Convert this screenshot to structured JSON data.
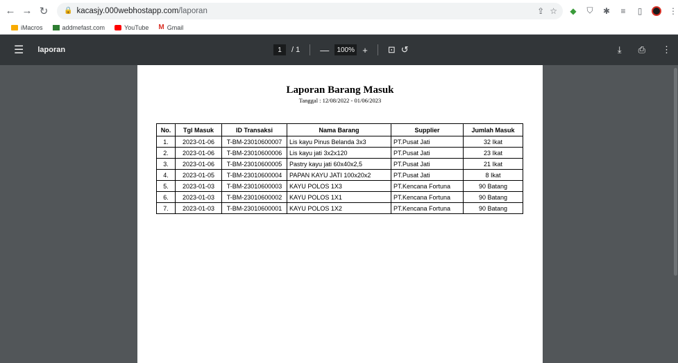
{
  "browser": {
    "url_host": "kacasjy.000webhostapp.com",
    "url_path": "/laporan",
    "bookmarks": [
      "iMacros",
      "addmefast.com",
      "YouTube",
      "Gmail"
    ]
  },
  "pdf_toolbar": {
    "title": "laporan",
    "page_current": "1",
    "page_total": "/  1",
    "zoom": "100%"
  },
  "report": {
    "title": "Laporan Barang Masuk",
    "date_range": "Tanggal : 12/08/2022 - 01/06/2023",
    "columns": [
      "No.",
      "Tgl Masuk",
      "ID Transaksi",
      "Nama Barang",
      "Supplier",
      "Jumlah Masuk"
    ],
    "rows": [
      [
        "1.",
        "2023-01-06",
        "T-BM-23010600007",
        "Lis kayu Pinus Belanda 3x3",
        "PT.Pusat Jati",
        "32 Ikat"
      ],
      [
        "2.",
        "2023-01-06",
        "T-BM-23010600006",
        "Lis kayu jati 3x2x120",
        "PT.Pusat Jati",
        "23 Ikat"
      ],
      [
        "3.",
        "2023-01-06",
        "T-BM-23010600005",
        "Pastry  kayu jati 60x40x2,5",
        "PT.Pusat Jati",
        "21 Ikat"
      ],
      [
        "4.",
        "2023-01-05",
        "T-BM-23010600004",
        "PAPAN KAYU JATI 100x20x2",
        "PT.Pusat Jati",
        "8 Ikat"
      ],
      [
        "5.",
        "2023-01-03",
        "T-BM-23010600003",
        "KAYU POLOS 1X3",
        "PT.Kencana Fortuna",
        "90 Batang"
      ],
      [
        "6.",
        "2023-01-03",
        "T-BM-23010600002",
        "KAYU POLOS 1X1",
        "PT.Kencana Fortuna",
        "90 Batang"
      ],
      [
        "7.",
        "2023-01-03",
        "T-BM-23010600001",
        "KAYU POLOS 1X2",
        "PT.Kencana Fortuna",
        "90 Batang"
      ]
    ]
  }
}
